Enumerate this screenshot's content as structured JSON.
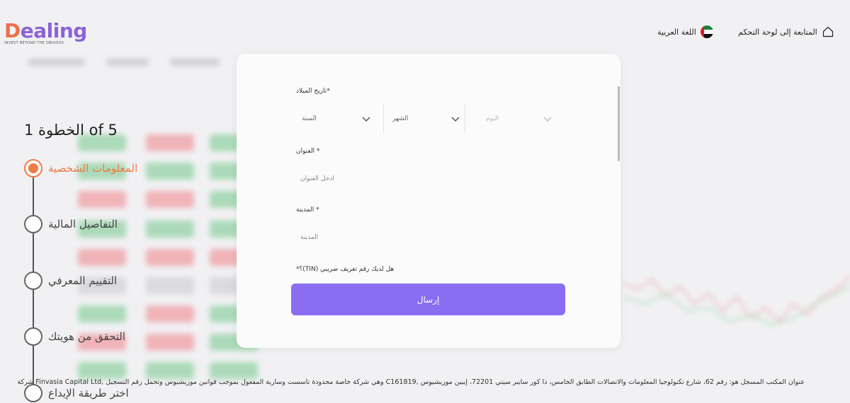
{
  "header": {
    "logo_text_d": "D",
    "logo_text_rest": "ealing",
    "logo_tagline": "INVEST BEYOND THE OBVIOUS",
    "language_label": "اللغة العربية",
    "dashboard_label": "المتابعة إلى لوحة التحكم",
    "flag_icon": "uae-flag-icon",
    "home_icon": "home-icon"
  },
  "stepper": {
    "title": "الخطوة 1 of 5",
    "steps": [
      {
        "label": "المعلومات الشخصية",
        "active": true
      },
      {
        "label": "التفاصيل المالية",
        "active": false
      },
      {
        "label": "التقييم المعرفي",
        "active": false
      },
      {
        "label": "التحقق من هويتك",
        "active": false
      },
      {
        "label": "اختر طريقة الإيداع",
        "active": false
      }
    ]
  },
  "form": {
    "dob_label": "*تاريخ الميلاد",
    "year_placeholder": "السنة",
    "month_placeholder": "الشهر",
    "day_placeholder": "اليوم",
    "address_label": "* العنوان",
    "address_placeholder": "أدخل العنوان",
    "city_label": "* المدينة",
    "city_placeholder": "المدينة",
    "tin_label": "هل لديك رقم تعريف ضريبي (TIN)؟*",
    "submit_label": "إرسال"
  },
  "footer": {
    "text": "عنوان المكتب المسجل هو: رقم 62، شارع تكنولوجيا المعلومات والاتصالات الطابق الخامس، ذا كور سايبر سيتي 72201، إيبين موريشيوس ,C161819 وهي شركة خاصة محدودة تأسست وسارية المفعول بموجب قوانين موريشيوس وتحمل رقم التسجيل ,Finvasia Capital Ltd شركة"
  },
  "colors": {
    "accent_purple": "#8a6df0",
    "active_orange": "#ef7b45",
    "logo_orange": "#ef6e4b",
    "logo_purple": "#8c63d8"
  }
}
